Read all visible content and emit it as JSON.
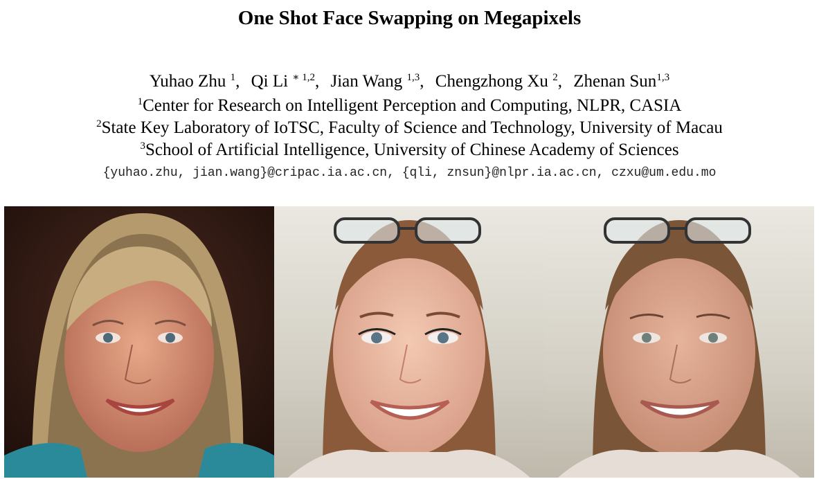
{
  "paper": {
    "title": "One Shot Face Swapping on Megapixels",
    "authors": [
      {
        "name": "Yuhao Zhu",
        "sup": "1"
      },
      {
        "name": "Qi Li",
        "sup": "∗ 1,2"
      },
      {
        "name": "Jian Wang",
        "sup": "1,3"
      },
      {
        "name": "Chengzhong Xu",
        "sup": "2"
      },
      {
        "name": "Zhenan Sun",
        "sup": "1,3"
      }
    ],
    "affiliations": [
      {
        "sup": "1",
        "text": "Center for Research on Intelligent Perception and Computing, NLPR, CASIA"
      },
      {
        "sup": "2",
        "text": "State Key Laboratory of IoTSC, Faculty of Science and Technology, University of Macau"
      },
      {
        "sup": "3",
        "text": "School of Artificial Intelligence, University of Chinese Academy of Sciences"
      }
    ],
    "emails": "{yuhao.zhu, jian.wang}@cripac.ia.ac.cn, {qli, znsun}@nlpr.ia.ac.cn, czxu@um.edu.mo"
  },
  "figure": {
    "panels": [
      {
        "id": "source-face",
        "hair_color": "#b59a6e",
        "bg_color": "#2a1510",
        "shirt_color": "#2a8a9a"
      },
      {
        "id": "target-face",
        "hair_color": "#8a5a3a",
        "bg_color": "#d7d4ca",
        "shirt_color": "#e6ddd6"
      },
      {
        "id": "swapped-face",
        "hair_color": "#7a5538",
        "bg_color": "#d8d5cb",
        "shirt_color": "#e6ddd6"
      }
    ]
  }
}
